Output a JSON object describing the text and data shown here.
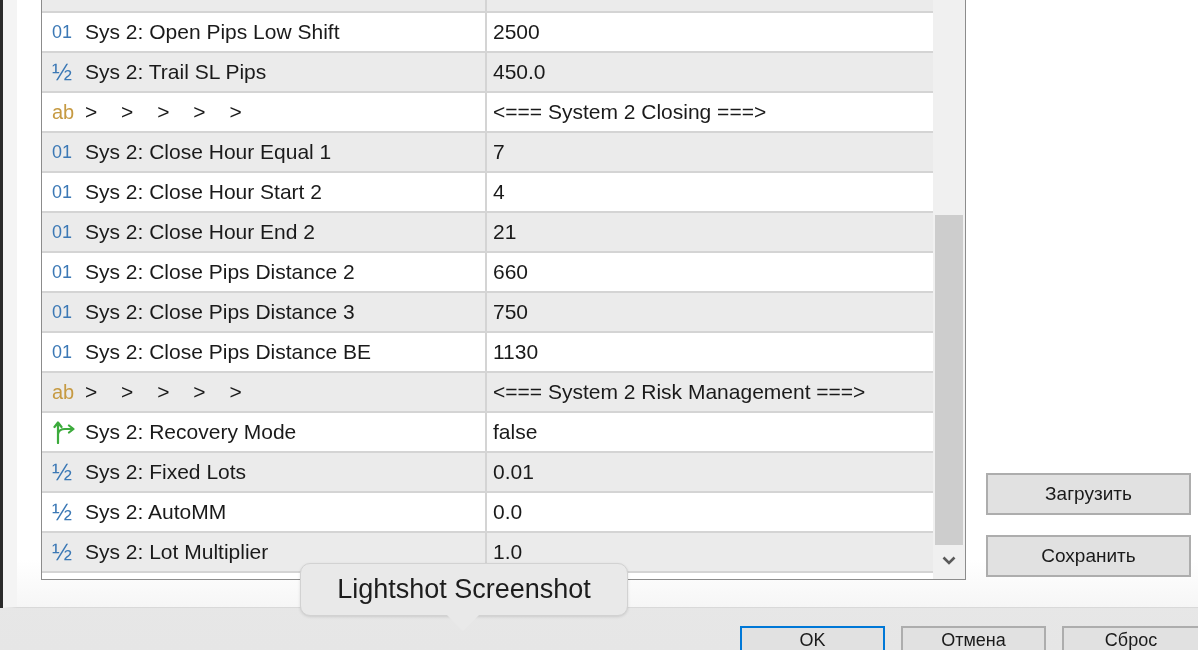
{
  "table": {
    "rows": [
      {
        "kind": "int",
        "type_glyph": "01",
        "name": "Sys 2: Open Pips Low Shift",
        "value": "2500"
      },
      {
        "kind": "double",
        "type_glyph": "½",
        "name": "Sys 2: Trail SL Pips",
        "value": "450.0"
      },
      {
        "kind": "string",
        "type_glyph": "ab",
        "name": "> > > > >",
        "value": "<=== System 2 Closing ===>"
      },
      {
        "kind": "int",
        "type_glyph": "01",
        "name": "Sys 2: Close Hour Equal 1",
        "value": "7"
      },
      {
        "kind": "int",
        "type_glyph": "01",
        "name": "Sys 2: Close Hour Start 2",
        "value": "4"
      },
      {
        "kind": "int",
        "type_glyph": "01",
        "name": "Sys 2: Close Hour End 2",
        "value": "21"
      },
      {
        "kind": "int",
        "type_glyph": "01",
        "name": "Sys 2: Close Pips Distance 2",
        "value": "660"
      },
      {
        "kind": "int",
        "type_glyph": "01",
        "name": "Sys 2: Close Pips Distance 3",
        "value": "750"
      },
      {
        "kind": "int",
        "type_glyph": "01",
        "name": "Sys 2: Close Pips Distance BE",
        "value": "1130"
      },
      {
        "kind": "string",
        "type_glyph": "ab",
        "name": "> > > > >",
        "value": "<=== System 2 Risk Management ===>"
      },
      {
        "kind": "bool",
        "name": "Sys 2: Recovery Mode",
        "value": "false"
      },
      {
        "kind": "double",
        "type_glyph": "½",
        "name": "Sys 2: Fixed Lots",
        "value": "0.01"
      },
      {
        "kind": "double",
        "type_glyph": "½",
        "name": "Sys 2: AutoMM",
        "value": "0.0"
      },
      {
        "kind": "double",
        "type_glyph": "½",
        "name": "Sys 2: Lot Multiplier",
        "value": "1.0"
      }
    ]
  },
  "side_buttons": [
    "Загрузить",
    "Сохранить"
  ],
  "dialog_buttons": [
    {
      "label": "OK",
      "default": true
    },
    {
      "label": "Отмена",
      "default": false
    },
    {
      "label": "Сброс",
      "default": false
    }
  ],
  "tooltip": {
    "text": "Lightshot Screenshot"
  }
}
